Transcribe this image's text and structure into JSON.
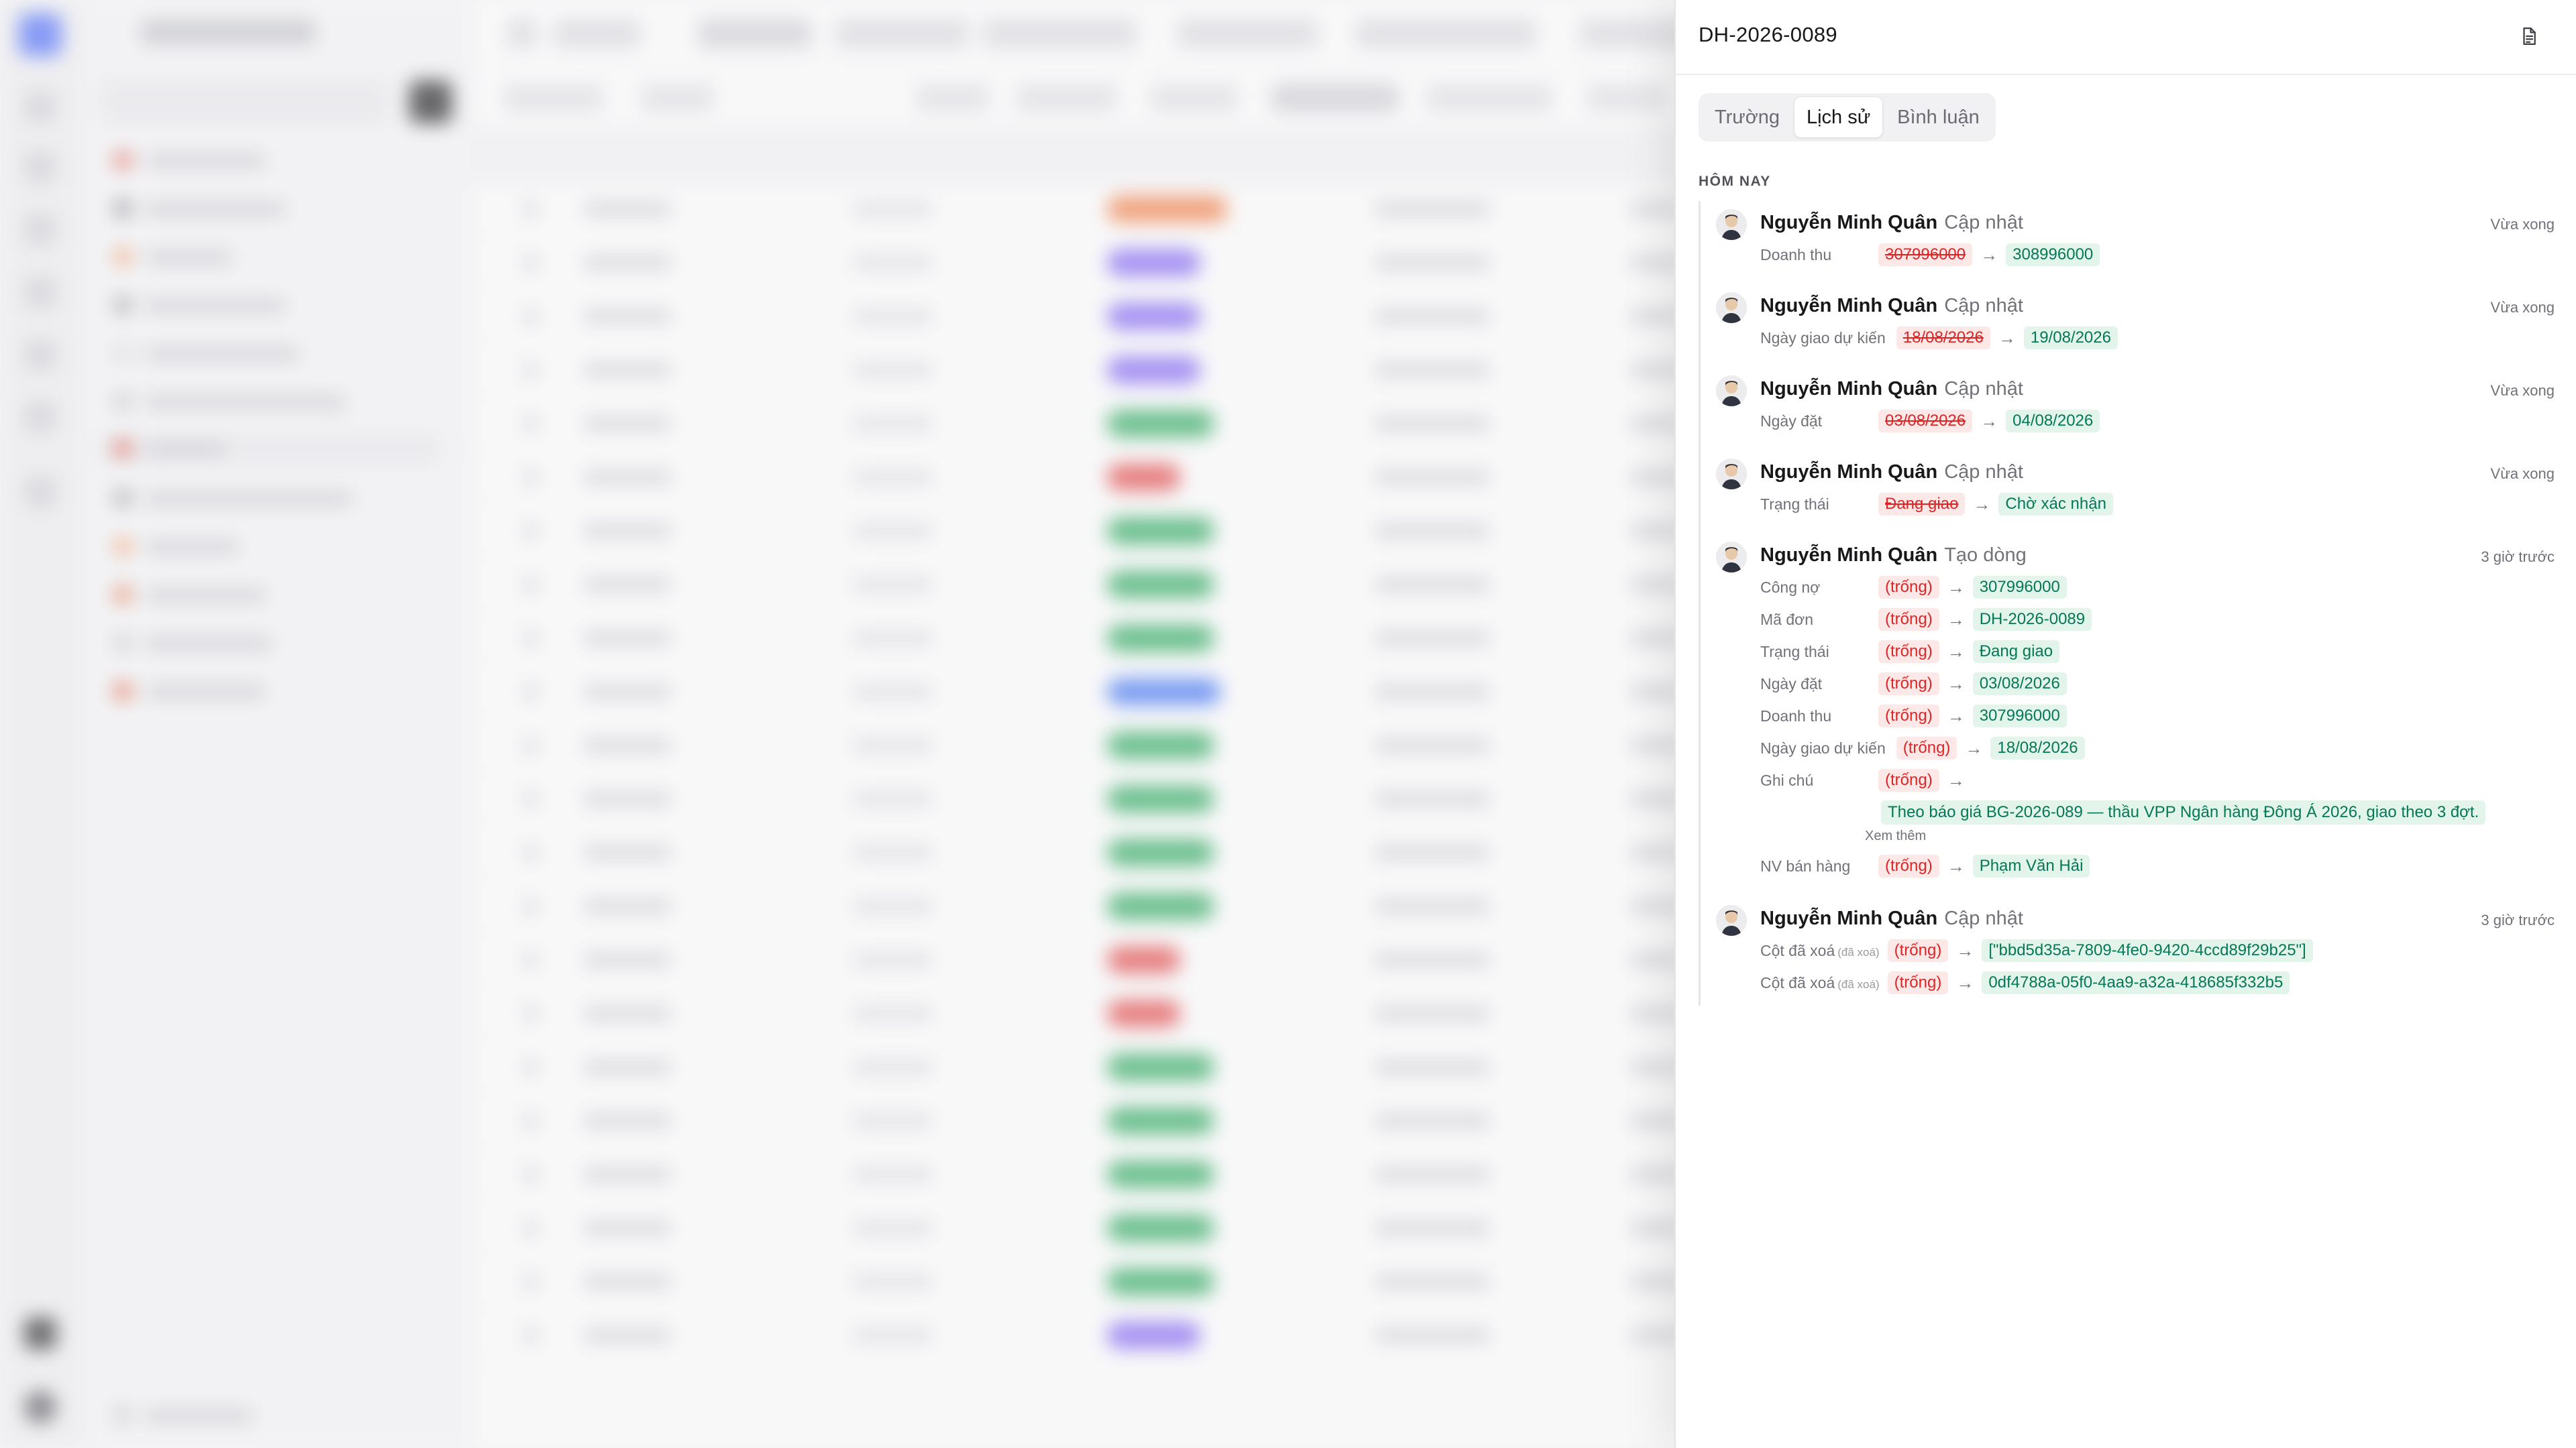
{
  "panel": {
    "title": "DH-2026-0089",
    "tabs": [
      {
        "label": "Trường",
        "active": false
      },
      {
        "label": "Lịch sử",
        "active": true
      },
      {
        "label": "Bình luận",
        "active": false
      }
    ],
    "section_label": "HÔM NAY",
    "icons": {
      "document": "document-icon",
      "close": "close-icon"
    }
  },
  "history": [
    {
      "user": "Nguyễn Minh Quân",
      "action": "Cập nhật",
      "time": "Vừa xong",
      "changes": [
        {
          "field": "Doanh thu",
          "old": "307996000",
          "new": "308996000"
        }
      ]
    },
    {
      "user": "Nguyễn Minh Quân",
      "action": "Cập nhật",
      "time": "Vừa xong",
      "changes": [
        {
          "field": "Ngày giao dự kiến",
          "old": "18/08/2026",
          "new": "19/08/2026"
        }
      ]
    },
    {
      "user": "Nguyễn Minh Quân",
      "action": "Cập nhật",
      "time": "Vừa xong",
      "changes": [
        {
          "field": "Ngày đặt",
          "old": "03/08/2026",
          "new": "04/08/2026"
        }
      ]
    },
    {
      "user": "Nguyễn Minh Quân",
      "action": "Cập nhật",
      "time": "Vừa xong",
      "changes": [
        {
          "field": "Trạng thái",
          "old": "Đang giao",
          "new": "Chờ xác nhận"
        }
      ]
    },
    {
      "user": "Nguyễn Minh Quân",
      "action": "Tạo dòng",
      "time": "3 giờ trước",
      "changes": [
        {
          "field": "Công nợ",
          "old": "(trống)",
          "new": "307996000"
        },
        {
          "field": "Mã đơn",
          "old": "(trống)",
          "new": "DH-2026-0089"
        },
        {
          "field": "Trạng thái",
          "old": "(trống)",
          "new": "Đang giao"
        },
        {
          "field": "Ngày đặt",
          "old": "(trống)",
          "new": "03/08/2026"
        },
        {
          "field": "Doanh thu",
          "old": "(trống)",
          "new": "307996000"
        },
        {
          "field": "Ngày giao dự kiến",
          "old": "(trống)",
          "new": "18/08/2026"
        },
        {
          "field": "Ghi chú",
          "old": "(trống)",
          "new": "Theo báo giá BG-2026-089 — thầu VPP Ngân hàng Đông Á 2026, giao theo 3 đợt.",
          "more": "Xem thêm"
        },
        {
          "field": "NV bán hàng",
          "old": "(trống)",
          "new": "Phạm Văn Hải"
        }
      ]
    },
    {
      "user": "Nguyễn Minh Quân",
      "action": "Cập nhật",
      "time": "3 giờ trước",
      "changes": [
        {
          "field": "Cột đã xoá",
          "tag": "(đã xoá)",
          "old": "(trống)",
          "new": "[\"bbd5d35a-7809-4fe0-9420-4ccd89f29b25\"]"
        },
        {
          "field": "Cột đã xoá",
          "tag": "(đã xoá)",
          "old": "(trống)",
          "new": "0df4788a-05f0-4aa9-a32a-418685f332b5"
        }
      ]
    }
  ],
  "colors": {
    "removed": "#dc2626",
    "added": "#047857",
    "removed_bg": "#fde8e8",
    "added_bg": "#e3f5ea"
  }
}
